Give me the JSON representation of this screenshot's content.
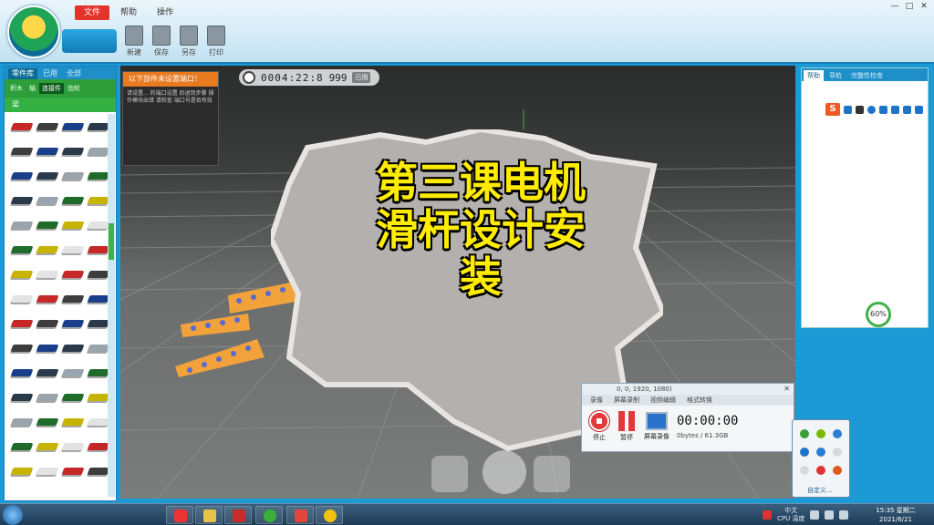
{
  "app": {
    "logo_label": "",
    "logo_name": "",
    "menu": [
      {
        "label": "文件",
        "active": true
      },
      {
        "label": "帮助",
        "active": false
      },
      {
        "label": "操作",
        "active": false
      }
    ],
    "toolbar": [
      {
        "label": "新建"
      },
      {
        "label": "保存"
      },
      {
        "label": "另存"
      },
      {
        "label": "打印"
      }
    ],
    "window_buttons": [
      "—",
      "□",
      "✕"
    ]
  },
  "left_panel": {
    "tabs": [
      "零件库",
      "已用",
      "全部"
    ],
    "categories": [
      "积木",
      "轴",
      "连接件",
      "齿轮"
    ],
    "sub_label": "梁"
  },
  "viewport": {
    "notice": {
      "title": "以下部件未设置端口！",
      "body": "请设置... 的端口设置 后退到步骤 操作模块出错 请检查 端口号是否有效"
    },
    "counter": {
      "time": "0004:22:8",
      "count": "999",
      "button": "已用"
    },
    "overlay_title": [
      "第三课电机",
      "滑杆设计安",
      "装"
    ]
  },
  "right_panel": {
    "tabs": [
      "帮助",
      "导航",
      "完整性检查"
    ],
    "percent": "60%"
  },
  "recorder": {
    "title": "0, 0, 1920, 1080)",
    "tabs": [
      "录像",
      "屏幕录制",
      "视频编辑",
      "格式转换"
    ],
    "stop_label": "停止",
    "pause_label": "暂停",
    "screen_label": "屏幕录像",
    "time": "00:00:00",
    "size": "0bytes / 61.3GB"
  },
  "tray_popup": {
    "label": "自定义..."
  },
  "taskbar": {
    "tray_text_top": "中文",
    "tray_text_bottom": "CPU 温度",
    "clock_time": "15:35 星期二",
    "clock_date": "2021/6/21"
  }
}
